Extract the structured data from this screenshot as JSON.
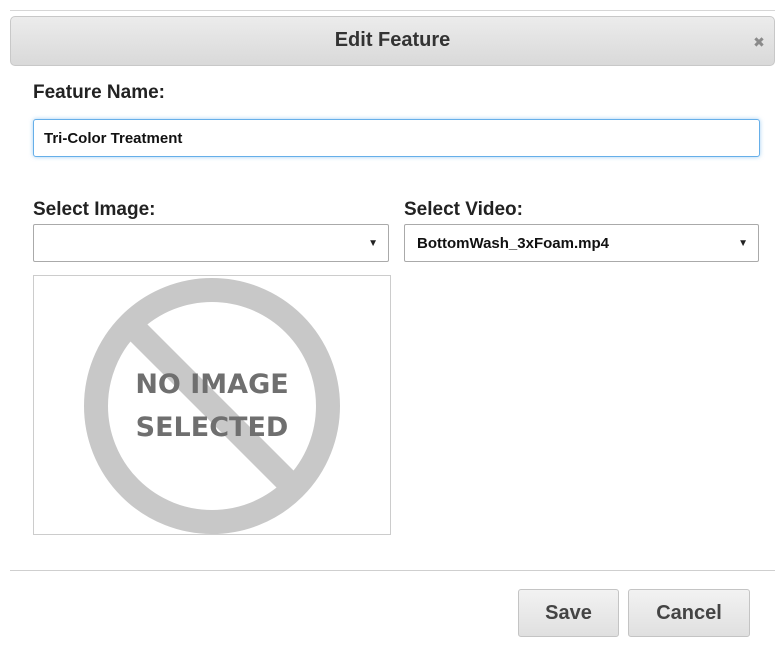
{
  "dialog": {
    "title": "Edit Feature",
    "close_icon": "close-icon",
    "close_glyph": "✖"
  },
  "feature_name": {
    "label": "Feature Name:",
    "value": "Tri-Color Treatment"
  },
  "select_image": {
    "label": "Select Image:",
    "selected": "",
    "arrow": "▼"
  },
  "select_video": {
    "label": "Select Video:",
    "selected": "BottomWash_3xFoam.mp4",
    "arrow": "▼"
  },
  "image_preview": {
    "placeholder_line1": "NO IMAGE",
    "placeholder_line2": "SELECTED",
    "icon": "no-image-icon",
    "color": "#c8c8c8",
    "text_color": "#6f6f6f"
  },
  "footer": {
    "save_label": "Save",
    "cancel_label": "Cancel"
  },
  "colors": {
    "focus_border": "#66afe9",
    "title_text": "#333333"
  }
}
